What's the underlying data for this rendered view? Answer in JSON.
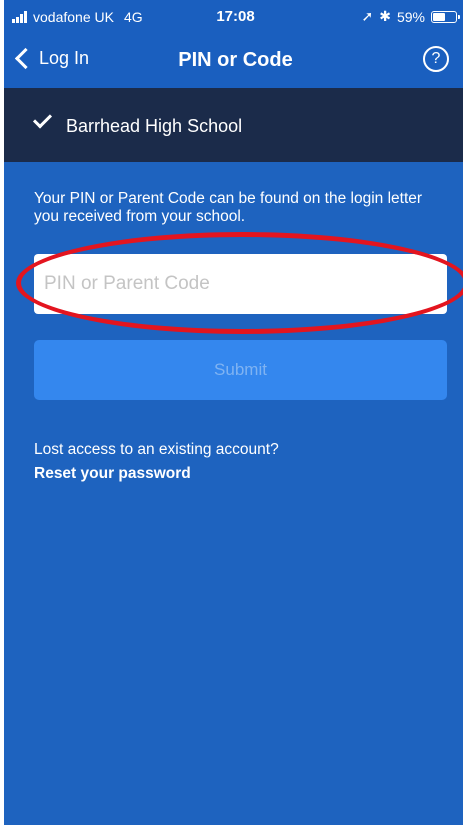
{
  "status_bar": {
    "carrier": "vodafone UK",
    "network": "4G",
    "time": "17:08",
    "location_icon": "location-arrow-icon",
    "bluetooth_icon": "bluetooth-icon",
    "battery_percent": "59%",
    "battery_level": 0.59
  },
  "nav": {
    "back_label": "Log In",
    "title": "PIN or Code",
    "help_label": "?"
  },
  "school": {
    "name": "Barrhead High School"
  },
  "main": {
    "instruction": "Your PIN or Parent Code can be found on the login letter you received from your school.",
    "pin_placeholder": "PIN or Parent Code",
    "pin_value": "",
    "submit_label": "Submit",
    "lost_access_text": "Lost access to an existing account?",
    "reset_label": "Reset your password"
  },
  "colors": {
    "background": "#1e63bf",
    "banner": "#1b2b4a",
    "submit_disabled": "#3487ee",
    "highlight": "#e3151f"
  }
}
